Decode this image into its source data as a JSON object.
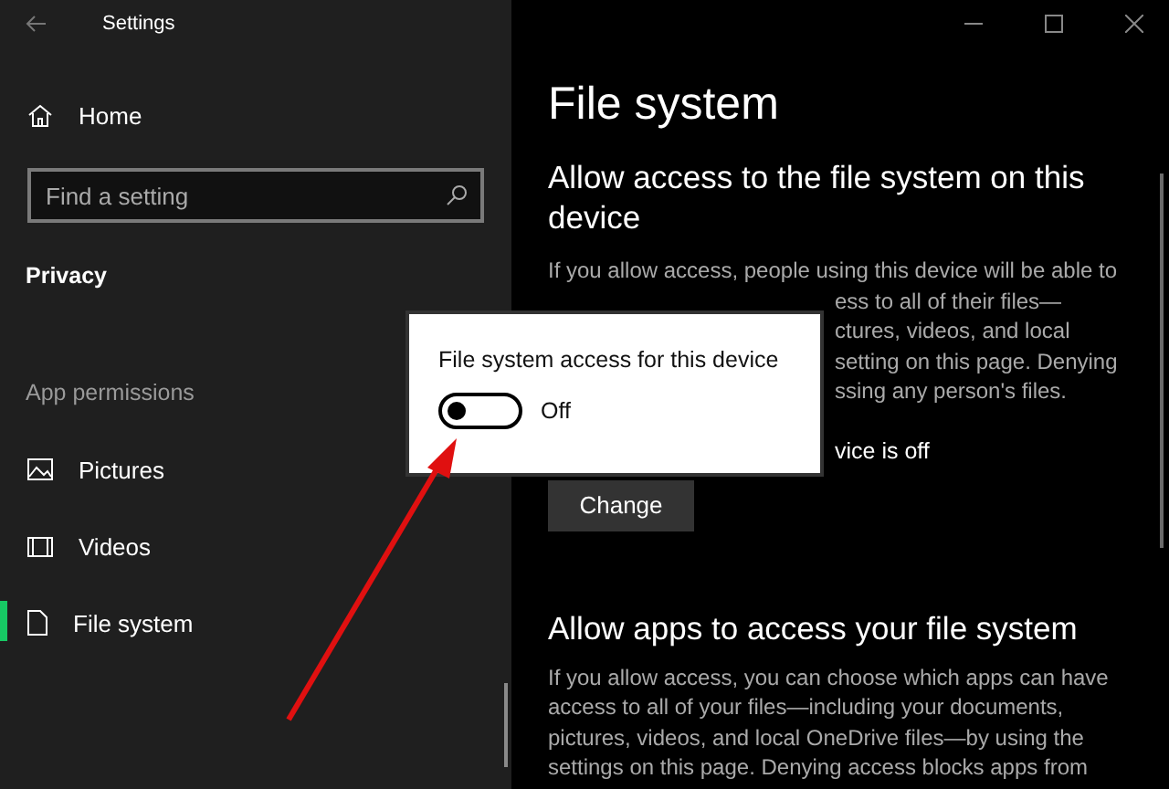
{
  "window": {
    "title": "Settings"
  },
  "sidebar": {
    "home": "Home",
    "search": {
      "placeholder": "Find a setting"
    },
    "section": "Privacy",
    "group": "App permissions",
    "items": [
      {
        "label": "Pictures",
        "kind": "picture",
        "selected": false
      },
      {
        "label": "Videos",
        "kind": "video",
        "selected": false
      },
      {
        "label": "File system",
        "kind": "file",
        "selected": true
      }
    ]
  },
  "content": {
    "title": "File system",
    "section1": {
      "heading": "Allow access to the file system on this device",
      "lines": [
        {
          "text": "If you allow access, people using this device will be able to",
          "kind": "full"
        },
        {
          "text": "ess to all of their files—",
          "kind": "partial"
        },
        {
          "text": "ctures, videos, and local",
          "kind": "partial"
        },
        {
          "text": "setting on this page. Denying",
          "kind": "partial"
        },
        {
          "text": "ssing any person's files.",
          "kind": "partial"
        }
      ],
      "status": "vice is off",
      "button": "Change"
    },
    "section2": {
      "heading": "Allow apps to access your file system",
      "lines": [
        "If you allow access, you can choose which apps can have",
        "access to all of your files—including your documents,",
        "pictures, videos, and local OneDrive files—by using the",
        "settings on this page. Denying access blocks apps from"
      ]
    }
  },
  "popup": {
    "label": "File system access for this device",
    "toggle": {
      "on": false,
      "state_text": "Off"
    }
  }
}
